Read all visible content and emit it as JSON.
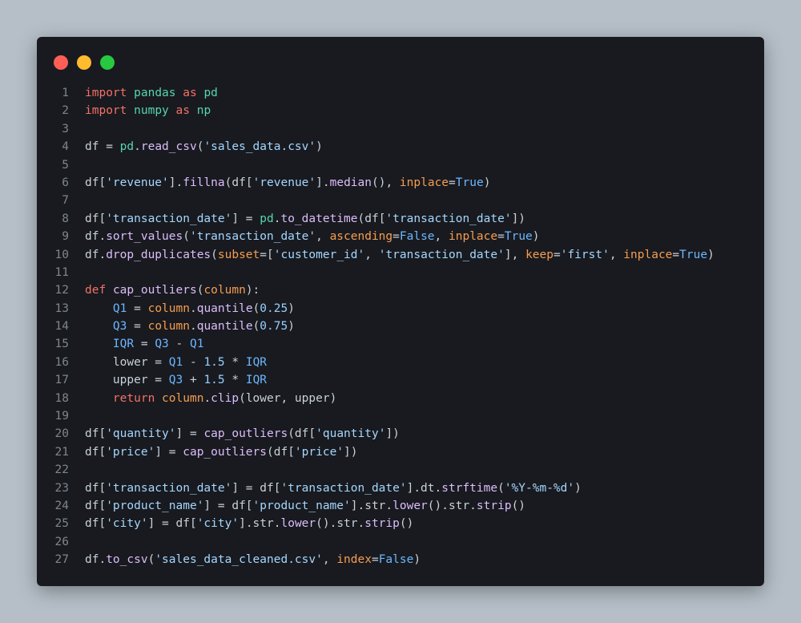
{
  "colors": {
    "window_background": "#181a1f",
    "page_background": "#b6bfc8",
    "dot_close": "#ff5f57",
    "dot_minimize": "#febc2e",
    "dot_maximize": "#28c840",
    "line_number": "#7d8590"
  },
  "window": {
    "controls": [
      "close-dot",
      "minimize-dot",
      "maximize-dot"
    ]
  },
  "code": {
    "language": "python",
    "lines": [
      {
        "number": "1",
        "tokens": [
          [
            "keyword",
            "import"
          ],
          [
            "default",
            " "
          ],
          [
            "module",
            "pandas"
          ],
          [
            "default",
            " "
          ],
          [
            "keyword",
            "as"
          ],
          [
            "default",
            " "
          ],
          [
            "alias",
            "pd"
          ]
        ]
      },
      {
        "number": "2",
        "tokens": [
          [
            "keyword",
            "import"
          ],
          [
            "default",
            " "
          ],
          [
            "module",
            "numpy"
          ],
          [
            "default",
            " "
          ],
          [
            "keyword",
            "as"
          ],
          [
            "default",
            " "
          ],
          [
            "alias",
            "np"
          ]
        ]
      },
      {
        "number": "3",
        "tokens": []
      },
      {
        "number": "4",
        "tokens": [
          [
            "default",
            "df = "
          ],
          [
            "builtin",
            "pd"
          ],
          [
            "default",
            "."
          ],
          [
            "func",
            "read_csv"
          ],
          [
            "default",
            "("
          ],
          [
            "string",
            "'sales_data.csv'"
          ],
          [
            "default",
            ")"
          ]
        ]
      },
      {
        "number": "5",
        "tokens": []
      },
      {
        "number": "6",
        "tokens": [
          [
            "default",
            "df["
          ],
          [
            "string",
            "'revenue'"
          ],
          [
            "default",
            "]."
          ],
          [
            "func",
            "fillna"
          ],
          [
            "default",
            "(df["
          ],
          [
            "string",
            "'revenue'"
          ],
          [
            "default",
            "]."
          ],
          [
            "func",
            "median"
          ],
          [
            "default",
            "(), "
          ],
          [
            "param",
            "inplace"
          ],
          [
            "default",
            "="
          ],
          [
            "const",
            "True"
          ],
          [
            "default",
            ")"
          ]
        ]
      },
      {
        "number": "7",
        "tokens": []
      },
      {
        "number": "8",
        "tokens": [
          [
            "default",
            "df["
          ],
          [
            "string",
            "'transaction_date'"
          ],
          [
            "default",
            "] = "
          ],
          [
            "builtin",
            "pd"
          ],
          [
            "default",
            "."
          ],
          [
            "func",
            "to_datetime"
          ],
          [
            "default",
            "(df["
          ],
          [
            "string",
            "'transaction_date'"
          ],
          [
            "default",
            "])"
          ]
        ]
      },
      {
        "number": "9",
        "tokens": [
          [
            "default",
            "df."
          ],
          [
            "func",
            "sort_values"
          ],
          [
            "default",
            "("
          ],
          [
            "string",
            "'transaction_date'"
          ],
          [
            "default",
            ", "
          ],
          [
            "param",
            "ascending"
          ],
          [
            "default",
            "="
          ],
          [
            "const",
            "False"
          ],
          [
            "default",
            ", "
          ],
          [
            "param",
            "inplace"
          ],
          [
            "default",
            "="
          ],
          [
            "const",
            "True"
          ],
          [
            "default",
            ")"
          ]
        ]
      },
      {
        "number": "10",
        "tokens": [
          [
            "default",
            "df."
          ],
          [
            "func",
            "drop_duplicates"
          ],
          [
            "default",
            "("
          ],
          [
            "param",
            "subset"
          ],
          [
            "default",
            "=["
          ],
          [
            "string",
            "'customer_id'"
          ],
          [
            "default",
            ", "
          ],
          [
            "string",
            "'transaction_date'"
          ],
          [
            "default",
            "], "
          ],
          [
            "param",
            "keep"
          ],
          [
            "default",
            "="
          ],
          [
            "string",
            "'first'"
          ],
          [
            "default",
            ", "
          ],
          [
            "param",
            "inplace"
          ],
          [
            "default",
            "="
          ],
          [
            "const",
            "True"
          ],
          [
            "default",
            ")"
          ]
        ]
      },
      {
        "number": "11",
        "tokens": []
      },
      {
        "number": "12",
        "tokens": [
          [
            "keyword",
            "def"
          ],
          [
            "default",
            " "
          ],
          [
            "func",
            "cap_outliers"
          ],
          [
            "default",
            "("
          ],
          [
            "param",
            "column"
          ],
          [
            "default",
            "):"
          ]
        ]
      },
      {
        "number": "13",
        "tokens": [
          [
            "default",
            "    "
          ],
          [
            "variable",
            "Q1"
          ],
          [
            "default",
            " = "
          ],
          [
            "param",
            "column"
          ],
          [
            "default",
            "."
          ],
          [
            "func",
            "quantile"
          ],
          [
            "default",
            "("
          ],
          [
            "number",
            "0.25"
          ],
          [
            "default",
            ")"
          ]
        ]
      },
      {
        "number": "14",
        "tokens": [
          [
            "default",
            "    "
          ],
          [
            "variable",
            "Q3"
          ],
          [
            "default",
            " = "
          ],
          [
            "param",
            "column"
          ],
          [
            "default",
            "."
          ],
          [
            "func",
            "quantile"
          ],
          [
            "default",
            "("
          ],
          [
            "number",
            "0.75"
          ],
          [
            "default",
            ")"
          ]
        ]
      },
      {
        "number": "15",
        "tokens": [
          [
            "default",
            "    "
          ],
          [
            "variable",
            "IQR"
          ],
          [
            "default",
            " = "
          ],
          [
            "variable",
            "Q3"
          ],
          [
            "default",
            " - "
          ],
          [
            "variable",
            "Q1"
          ]
        ]
      },
      {
        "number": "16",
        "tokens": [
          [
            "default",
            "    lower = "
          ],
          [
            "variable",
            "Q1"
          ],
          [
            "default",
            " - "
          ],
          [
            "number",
            "1.5"
          ],
          [
            "default",
            " * "
          ],
          [
            "variable",
            "IQR"
          ]
        ]
      },
      {
        "number": "17",
        "tokens": [
          [
            "default",
            "    upper = "
          ],
          [
            "variable",
            "Q3"
          ],
          [
            "default",
            " + "
          ],
          [
            "number",
            "1.5"
          ],
          [
            "default",
            " * "
          ],
          [
            "variable",
            "IQR"
          ]
        ]
      },
      {
        "number": "18",
        "tokens": [
          [
            "default",
            "    "
          ],
          [
            "keyword",
            "return"
          ],
          [
            "default",
            " "
          ],
          [
            "param",
            "column"
          ],
          [
            "default",
            "."
          ],
          [
            "func",
            "clip"
          ],
          [
            "default",
            "(lower, upper)"
          ]
        ]
      },
      {
        "number": "19",
        "tokens": []
      },
      {
        "number": "20",
        "tokens": [
          [
            "default",
            "df["
          ],
          [
            "string",
            "'quantity'"
          ],
          [
            "default",
            "] = "
          ],
          [
            "func",
            "cap_outliers"
          ],
          [
            "default",
            "(df["
          ],
          [
            "string",
            "'quantity'"
          ],
          [
            "default",
            "])"
          ]
        ]
      },
      {
        "number": "21",
        "tokens": [
          [
            "default",
            "df["
          ],
          [
            "string",
            "'price'"
          ],
          [
            "default",
            "] = "
          ],
          [
            "func",
            "cap_outliers"
          ],
          [
            "default",
            "(df["
          ],
          [
            "string",
            "'price'"
          ],
          [
            "default",
            "])"
          ]
        ]
      },
      {
        "number": "22",
        "tokens": []
      },
      {
        "number": "23",
        "tokens": [
          [
            "default",
            "df["
          ],
          [
            "string",
            "'transaction_date'"
          ],
          [
            "default",
            "] = df["
          ],
          [
            "string",
            "'transaction_date'"
          ],
          [
            "default",
            "].dt."
          ],
          [
            "func",
            "strftime"
          ],
          [
            "default",
            "("
          ],
          [
            "string",
            "'%Y-%m-%d'"
          ],
          [
            "default",
            ")"
          ]
        ]
      },
      {
        "number": "24",
        "tokens": [
          [
            "default",
            "df["
          ],
          [
            "string",
            "'product_name'"
          ],
          [
            "default",
            "] = df["
          ],
          [
            "string",
            "'product_name'"
          ],
          [
            "default",
            "].str."
          ],
          [
            "func",
            "lower"
          ],
          [
            "default",
            "().str."
          ],
          [
            "func",
            "strip"
          ],
          [
            "default",
            "()"
          ]
        ]
      },
      {
        "number": "25",
        "tokens": [
          [
            "default",
            "df["
          ],
          [
            "string",
            "'city'"
          ],
          [
            "default",
            "] = df["
          ],
          [
            "string",
            "'city'"
          ],
          [
            "default",
            "].str."
          ],
          [
            "func",
            "lower"
          ],
          [
            "default",
            "().str."
          ],
          [
            "func",
            "strip"
          ],
          [
            "default",
            "()"
          ]
        ]
      },
      {
        "number": "26",
        "tokens": []
      },
      {
        "number": "27",
        "tokens": [
          [
            "default",
            "df."
          ],
          [
            "func",
            "to_csv"
          ],
          [
            "default",
            "("
          ],
          [
            "string",
            "'sales_data_cleaned.csv'"
          ],
          [
            "default",
            ", "
          ],
          [
            "param",
            "index"
          ],
          [
            "default",
            "="
          ],
          [
            "const",
            "False"
          ],
          [
            "default",
            ")"
          ]
        ]
      }
    ]
  }
}
